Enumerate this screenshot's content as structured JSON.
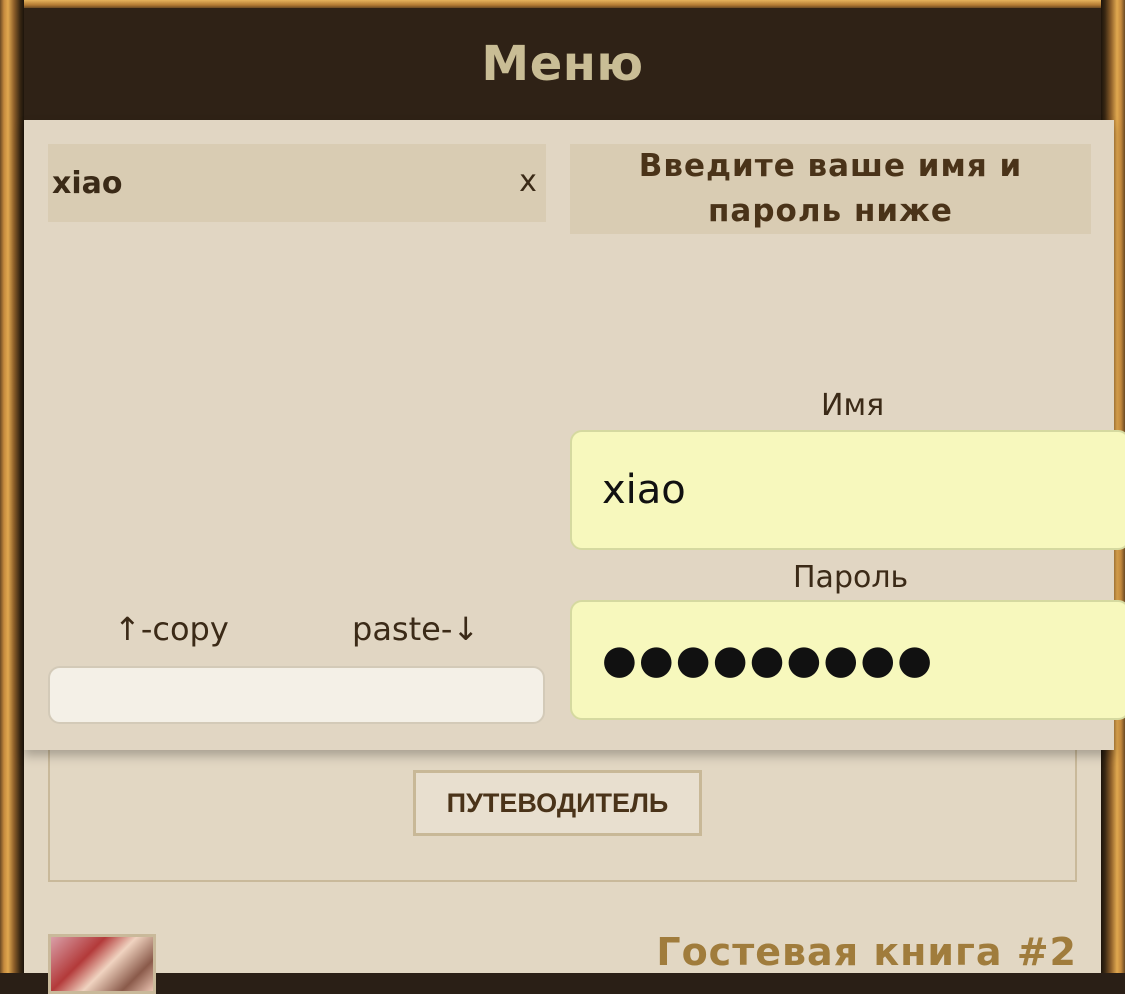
{
  "header": {
    "title": "Меню"
  },
  "menu": {
    "user_chip": {
      "name": "xiao",
      "close_label": "x"
    },
    "prompt": "Введите ваше имя и пароль ниже",
    "login": {
      "name_label": "Имя",
      "name_value": "xiao",
      "password_label": "Пароль",
      "password_value": "●●●●●●●●●"
    },
    "clipboard": {
      "copy_label": "↑-copy",
      "paste_label": "paste-↓",
      "value": ""
    }
  },
  "page": {
    "guide_button": "ПУТЕВОДИТЕЛЬ",
    "guestbook_title": "Гостевая книга #2"
  },
  "colors": {
    "header_bg": "#2f2216",
    "header_text": "#c9bd95",
    "panel_bg": "#e1d6c3",
    "input_bg": "#f7f8bd",
    "accent_text": "#a07c3c"
  }
}
